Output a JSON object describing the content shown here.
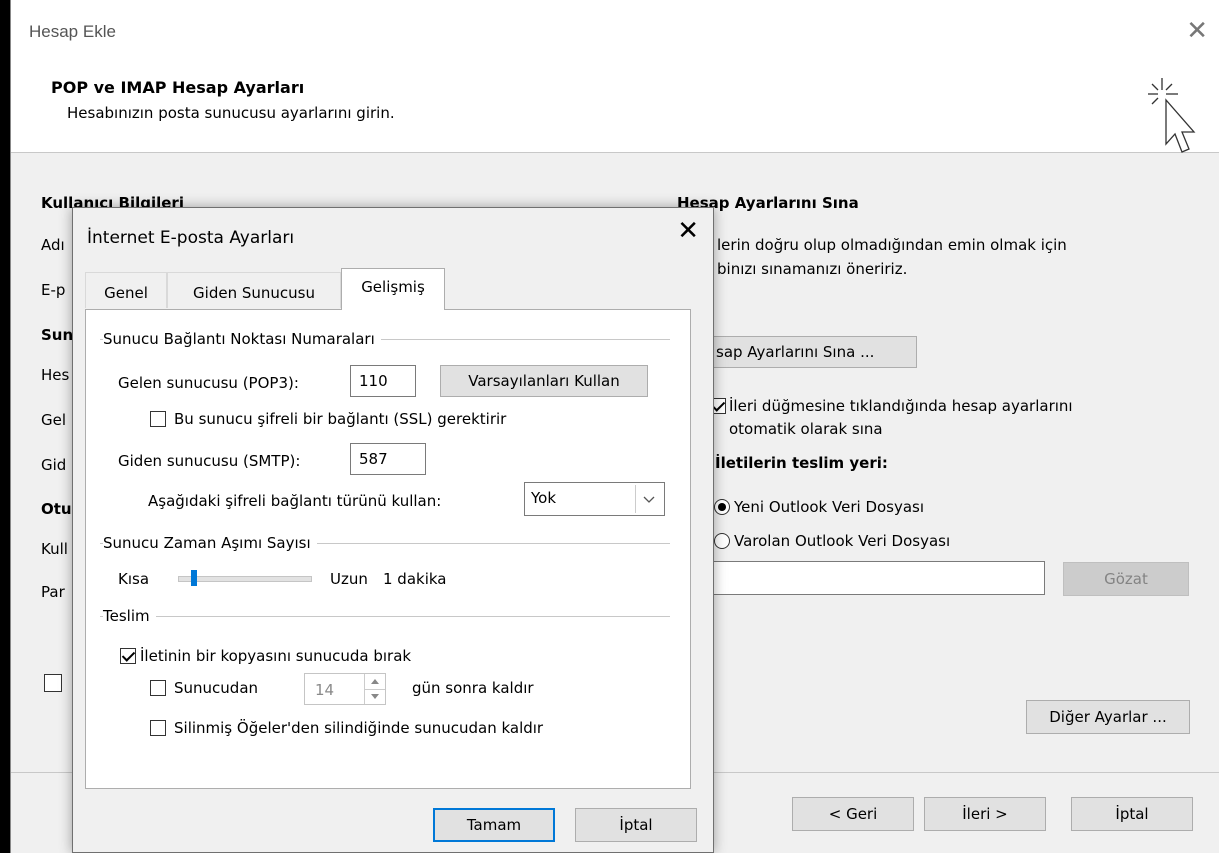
{
  "outer": {
    "title": "Hesap Ekle",
    "header_title": "POP ve IMAP Hesap Ayarları",
    "header_subtitle": "Hesabınızın posta sunucusu ayarlarını girin.",
    "left": {
      "section_user": "Kullanıcı Bilgileri",
      "row_name": "Adı",
      "row_email": "E-p",
      "section_server": "Sun",
      "row_account_type": "Hes",
      "row_incoming": "Gel",
      "row_outgoing": "Gid",
      "section_logon": "Otu",
      "row_user": "Kull",
      "row_password": "Par"
    },
    "right": {
      "section_test": "Hesap Ayarlarını Sına",
      "test_desc_1": "lerin doğru olup olmadığından emin olmak için",
      "test_desc_2": "binızı sınamanızı öneririz.",
      "test_button": "sap Ayarlarını Sına ...",
      "auto_test_1": "İleri düğmesine tıklandığında hesap ayarlarını",
      "auto_test_2": "otomatik olarak sına",
      "deliver_heading": "İletilerin teslim yeri:",
      "radio_new": "Yeni Outlook Veri Dosyası",
      "radio_existing": "Varolan Outlook Veri Dosyası",
      "browse_button": "Gözat",
      "more_settings_button": "Diğer Ayarlar ..."
    },
    "footer": {
      "back": "< Geri",
      "next": "İleri >",
      "cancel": "İptal"
    }
  },
  "dialog": {
    "title": "İnternet E-posta Ayarları",
    "tabs": [
      "Genel",
      "Giden Sunucusu",
      "Gelişmiş"
    ],
    "ports_group": "Sunucu Bağlantı Noktası Numaraları",
    "incoming_label": "Gelen sunucusu (POP3):",
    "incoming_value": "110",
    "use_defaults": "Varsayılanları Kullan",
    "ssl_label": "Bu sunucu şifreli bir bağlantı (SSL) gerektirir",
    "outgoing_label": "Giden sunucusu (SMTP):",
    "outgoing_value": "587",
    "encryption_label": "Aşağıdaki şifreli bağlantı türünü kullan:",
    "encryption_value": "Yok",
    "timeout_group": "Sunucu Zaman Aşımı Sayısı",
    "timeout_short": "Kısa",
    "timeout_long": "Uzun",
    "timeout_value": "1 dakika",
    "timeout_level": 0.1,
    "delivery_group": "Teslim",
    "leave_copy": "İletinin bir kopyasını sunucuda bırak",
    "remove_after": "Sunucudan",
    "remove_days": "14",
    "remove_after_suffix": "gün sonra kaldır",
    "remove_deleted": "Silinmiş Öğeler'den silindiğinde sunucudan kaldır",
    "ok": "Tamam",
    "cancel": "İptal"
  }
}
